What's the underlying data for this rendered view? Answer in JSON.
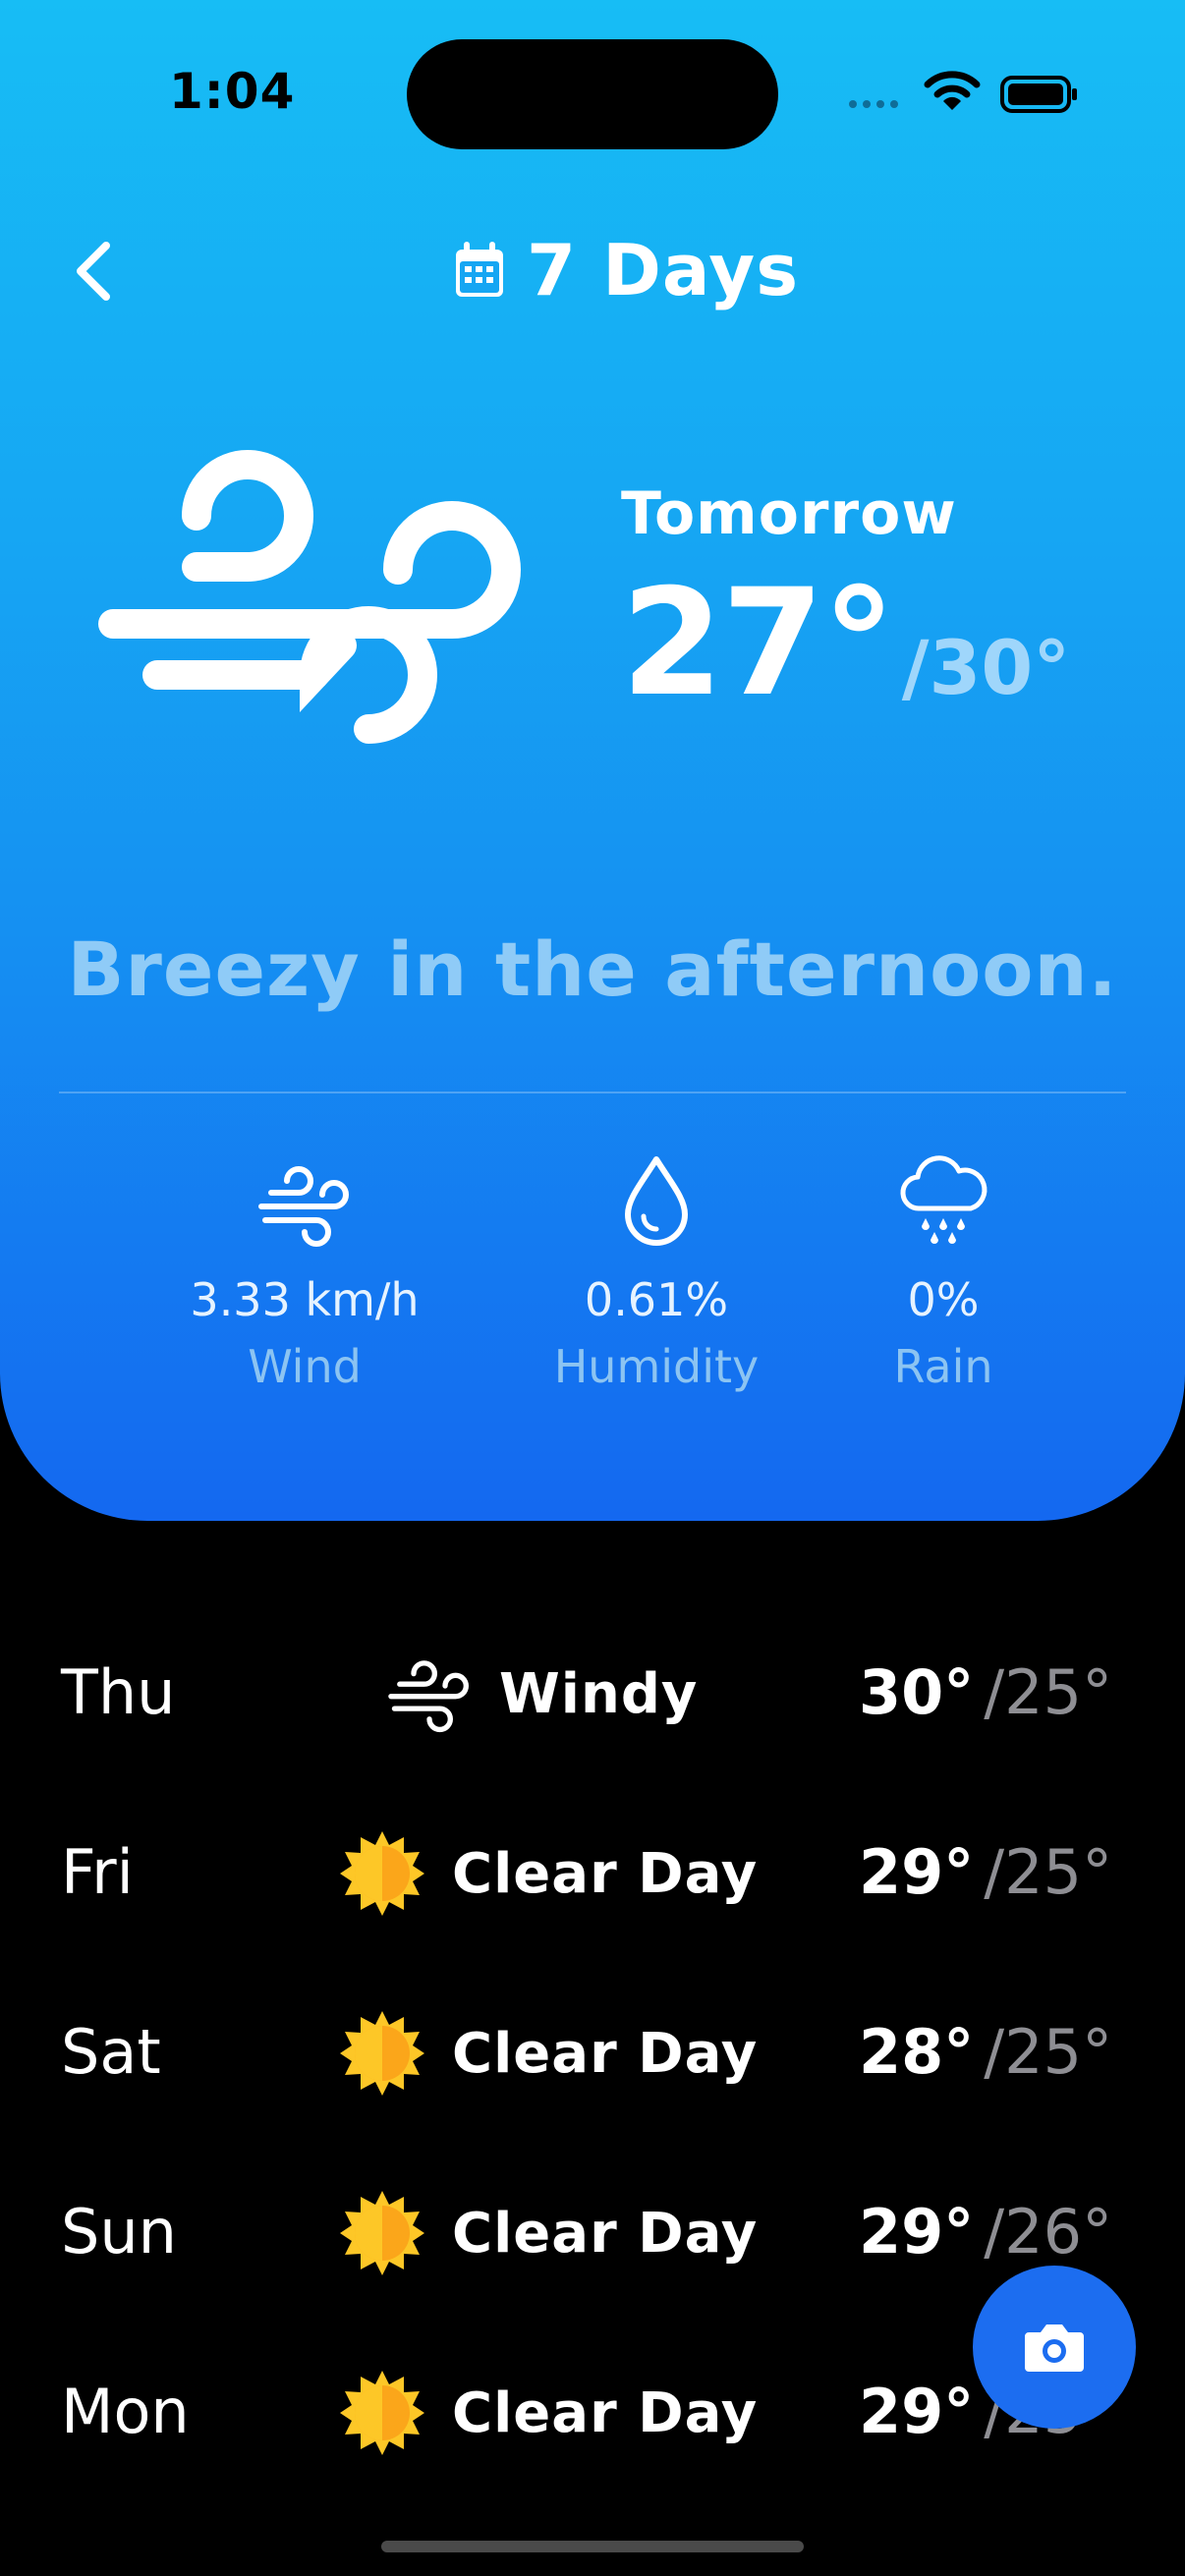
{
  "status_bar": {
    "time": "1:04"
  },
  "header": {
    "title": "7 Days",
    "title_icon": "calendar-icon",
    "back_icon": "chevron-left-icon"
  },
  "featured": {
    "day_label": "Tomorrow",
    "high": "27°",
    "low": "/30°",
    "icon": "wind-icon",
    "summary": "Breezy in the afternoon."
  },
  "stats": [
    {
      "icon": "wind-icon",
      "value": "3.33 km/h",
      "label": "Wind"
    },
    {
      "icon": "humidity-drop-icon",
      "value": "0.61%",
      "label": "Humidity"
    },
    {
      "icon": "rain-cloud-icon",
      "value": "0%",
      "label": "Rain"
    }
  ],
  "forecast": [
    {
      "day": "Thu",
      "icon": "wind-icon",
      "condition": "Windy",
      "high": "30°",
      "low": "/25°"
    },
    {
      "day": "Fri",
      "icon": "sun-icon",
      "condition": "Clear Day",
      "high": "29°",
      "low": "/25°"
    },
    {
      "day": "Sat",
      "icon": "sun-icon",
      "condition": "Clear Day",
      "high": "28°",
      "low": "/25°"
    },
    {
      "day": "Sun",
      "icon": "sun-icon",
      "condition": "Clear Day",
      "high": "29°",
      "low": "/26°"
    },
    {
      "day": "Mon",
      "icon": "sun-icon",
      "condition": "Clear Day",
      "high": "29°",
      "low": "/25°"
    }
  ],
  "fab": {
    "icon": "camera-icon"
  },
  "colors": {
    "card_top": "#17bdf5",
    "card_bottom": "#1468f0",
    "fab": "#1c6df0",
    "sun": "#fdb813"
  }
}
